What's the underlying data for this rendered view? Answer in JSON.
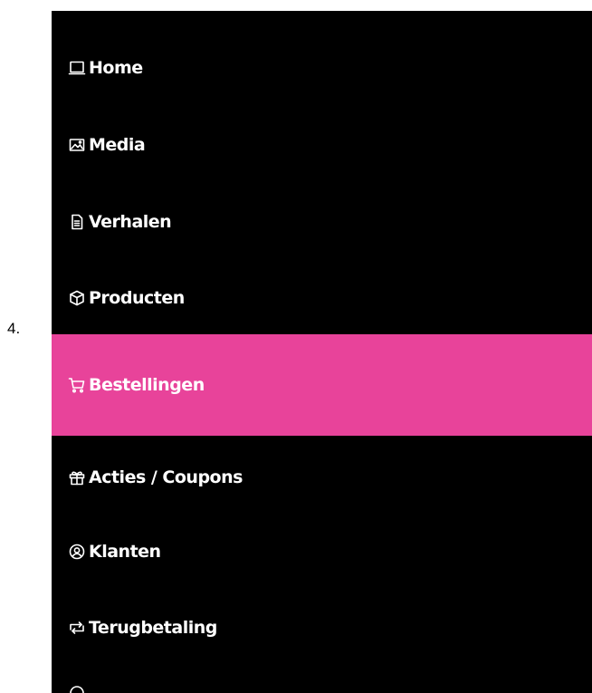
{
  "step_label": "4.",
  "sidebar": {
    "accent_color": "#e8439a",
    "background_color": "#000000",
    "items": [
      {
        "label": "Home",
        "icon": "laptop-icon",
        "active": false
      },
      {
        "label": "Media",
        "icon": "image-icon",
        "active": false
      },
      {
        "label": "Verhalen",
        "icon": "document-icon",
        "active": false
      },
      {
        "label": "Producten",
        "icon": "box-icon",
        "active": false
      },
      {
        "label": "Bestellingen",
        "icon": "cart-icon",
        "active": true
      },
      {
        "label": "Acties / Coupons",
        "icon": "gift-icon",
        "active": false
      },
      {
        "label": "Klanten",
        "icon": "user-circle-icon",
        "active": false
      },
      {
        "label": "Terugbetaling",
        "icon": "refund-icon",
        "active": false
      }
    ]
  }
}
